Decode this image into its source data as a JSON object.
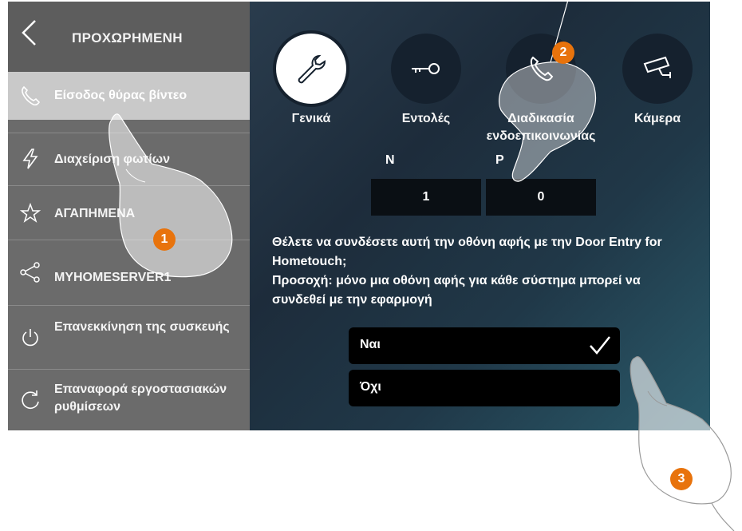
{
  "sidebar": {
    "title": "ΠΡΟΧΩΡΗΜΕΝΗ",
    "items": [
      {
        "label": "Είσοδος θύρας βίντεο",
        "icon": "phone-icon",
        "active": true
      },
      {
        "label": "Διαχείριση φωτίων",
        "icon": "lightning-icon",
        "active": false
      },
      {
        "label": "ΑΓΑΠΗΜΕΝΑ",
        "icon": "star-icon",
        "active": false
      },
      {
        "label": "MYHOMESERVER1",
        "icon": "share-icon",
        "active": false
      },
      {
        "label": "Επανεκκίνηση της συσκευής",
        "icon": "power-icon",
        "active": false
      },
      {
        "label": "Επαναφορά εργοστασιακών ρυθμίσεων",
        "icon": "reset-icon",
        "active": false
      }
    ]
  },
  "tabs": [
    {
      "label": "Γενικά",
      "icon": "wrench-icon",
      "selected": true
    },
    {
      "label": "Εντολές",
      "icon": "key-icon",
      "selected": false
    },
    {
      "label": "Διαδικασία ενδοεπικοινωνίας",
      "icon": "phone-icon",
      "selected": false
    },
    {
      "label": "Κάμερα",
      "icon": "camera-icon",
      "selected": false
    }
  ],
  "address": {
    "n_label": "N",
    "p_label": "P",
    "n_value": "1",
    "p_value": "0"
  },
  "prompt": {
    "line1": "Θέλετε να συνδέσετε αυτή την οθόνη αφής με την Door Entry for Hometouch;",
    "line2": "Προσοχή: μόνο μια οθόνη αφής για κάθε σύστημα μπορεί να συνδεθεί με την εφαρμογή"
  },
  "options": [
    {
      "label": "Ναι",
      "checked": true
    },
    {
      "label": "Όχι",
      "checked": false
    }
  ],
  "markers": [
    "1",
    "2",
    "3"
  ],
  "colors": {
    "accent": "#e8730c",
    "sidebar_bg": "#6b6b6b",
    "main_bg": "#1d2c3b"
  }
}
